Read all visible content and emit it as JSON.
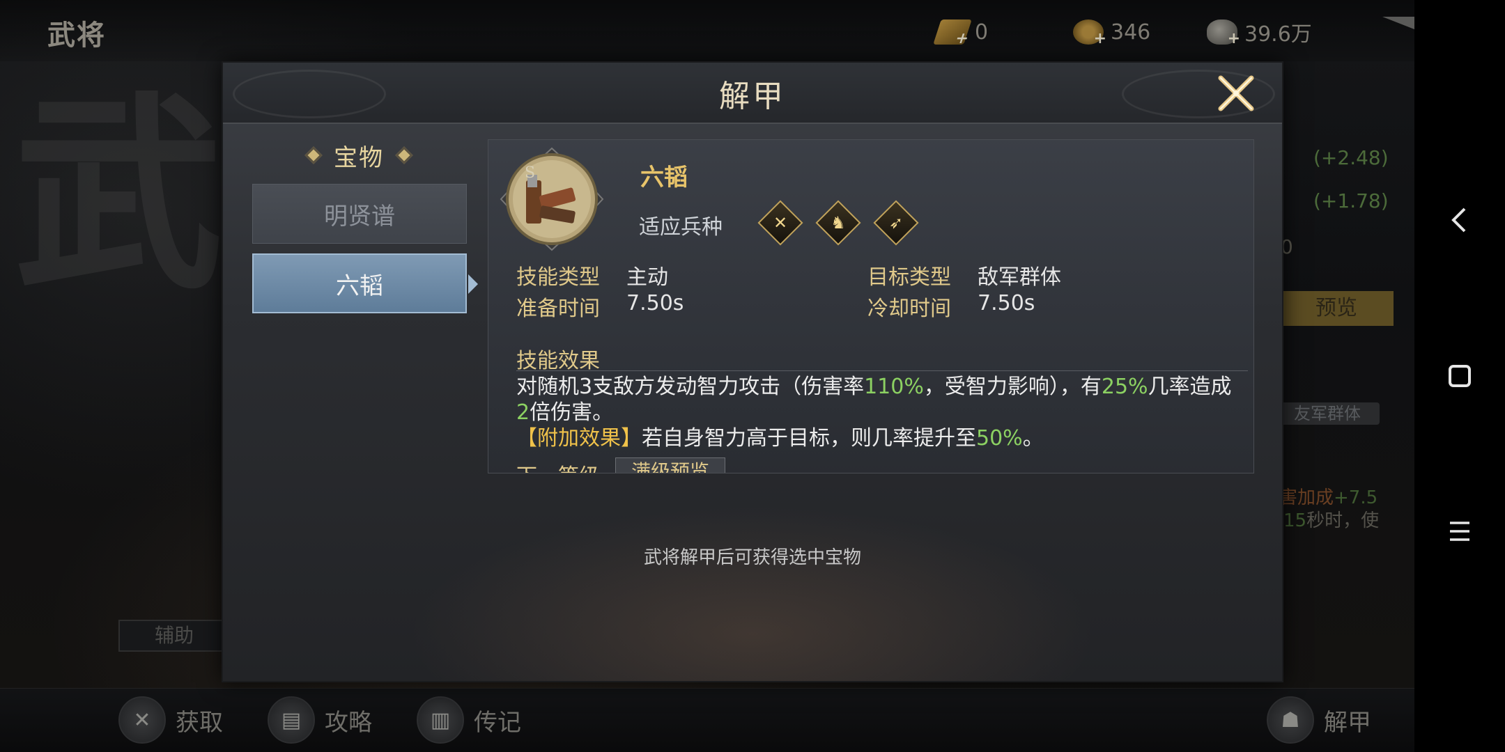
{
  "topbar": {
    "title": "武将",
    "currencies": [
      {
        "icon": "ingot-icon",
        "value": "0"
      },
      {
        "icon": "coin-icon",
        "value": "346"
      },
      {
        "icon": "silver-bag-icon",
        "value": "39.6万"
      }
    ]
  },
  "background_panel": {
    "stat1": "(+2.48)",
    "stat2": "(+1.78)",
    "zero": "0",
    "preview_label": "预览",
    "target_tag": "友军群体",
    "text1_a": "害加成",
    "text1_b": "+7.5",
    "text2_a": "15",
    "text2_b": "秒时，使",
    "assist_label": "辅助"
  },
  "bottombar": {
    "items": [
      {
        "label": "获取",
        "icon": "obtain-icon"
      },
      {
        "label": "攻略",
        "icon": "guide-icon"
      },
      {
        "label": "传记",
        "icon": "biography-icon"
      },
      {
        "label": "解甲",
        "icon": "unequip-icon"
      }
    ]
  },
  "modal": {
    "title": "解甲",
    "category_title": "宝物",
    "categories": [
      {
        "label": "明贤谱",
        "selected": false
      },
      {
        "label": "六韬",
        "selected": true
      }
    ],
    "item": {
      "name": "六韬",
      "troop_label": "适应兵种",
      "troop_icons": [
        "spear-icon",
        "cavalry-icon",
        "bow-icon"
      ],
      "skill_type_label": "技能类型",
      "skill_type_value": "主动",
      "target_type_label": "目标类型",
      "target_type_value": "敌军群体",
      "prep_time_label": "准备时间",
      "prep_time_value": "7.50s",
      "cooldown_label": "冷却时间",
      "cooldown_value": "7.50s",
      "effect_title": "技能效果",
      "effect_p1": "对随机3支敌方发动智力攻击（伤害率",
      "effect_v1": "110%",
      "effect_p2": "，受智力影响），有",
      "effect_v2": "25%",
      "effect_p3": "几率造成",
      "effect_v3": "2",
      "effect_p4": "倍伤害。",
      "bonus_tag": "【附加效果】",
      "bonus_p1": "若自身智力高于目标，则几率提升至",
      "bonus_v1": "50%",
      "bonus_p2": "。",
      "next_level_label": "下一等级",
      "max_level_label": "满级预览"
    },
    "hint": "武将解甲后可获得选中宝物"
  },
  "colors": {
    "accent_gold": "#e0c98a",
    "highlight_green": "#8cd162",
    "selected_blue": "#6c88a5"
  }
}
